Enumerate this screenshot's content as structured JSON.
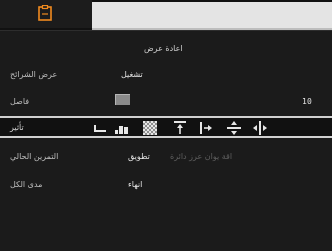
{
  "tabs": {
    "active_icon": "clipboard-icon",
    "inactive_tab": ""
  },
  "panel": {
    "title": "اعادة عرض",
    "rows": [
      {
        "label": "عرض الشرائح",
        "value": "تشغيل"
      },
      {
        "label": "فاصل",
        "value": "10",
        "slider_icon": "slider-knob"
      },
      {
        "label": "تأثير",
        "icons": [
          "carriage-return-icon",
          "bar-chart-icon",
          "checker-icon",
          "align-top-icon",
          "push-right-icon",
          "split-vertical-icon",
          "split-horizontal-icon"
        ]
      },
      {
        "label": "التمرين الحالي",
        "value": "تطويق",
        "extra": "اقة يوان عرز دائرة"
      },
      {
        "label": "مدى الكل",
        "value": "انهاء"
      }
    ]
  },
  "colors": {
    "background": "#1b1b1b",
    "highlight_border": "#d0d0d0",
    "accent_orange": "#f08a1e"
  }
}
